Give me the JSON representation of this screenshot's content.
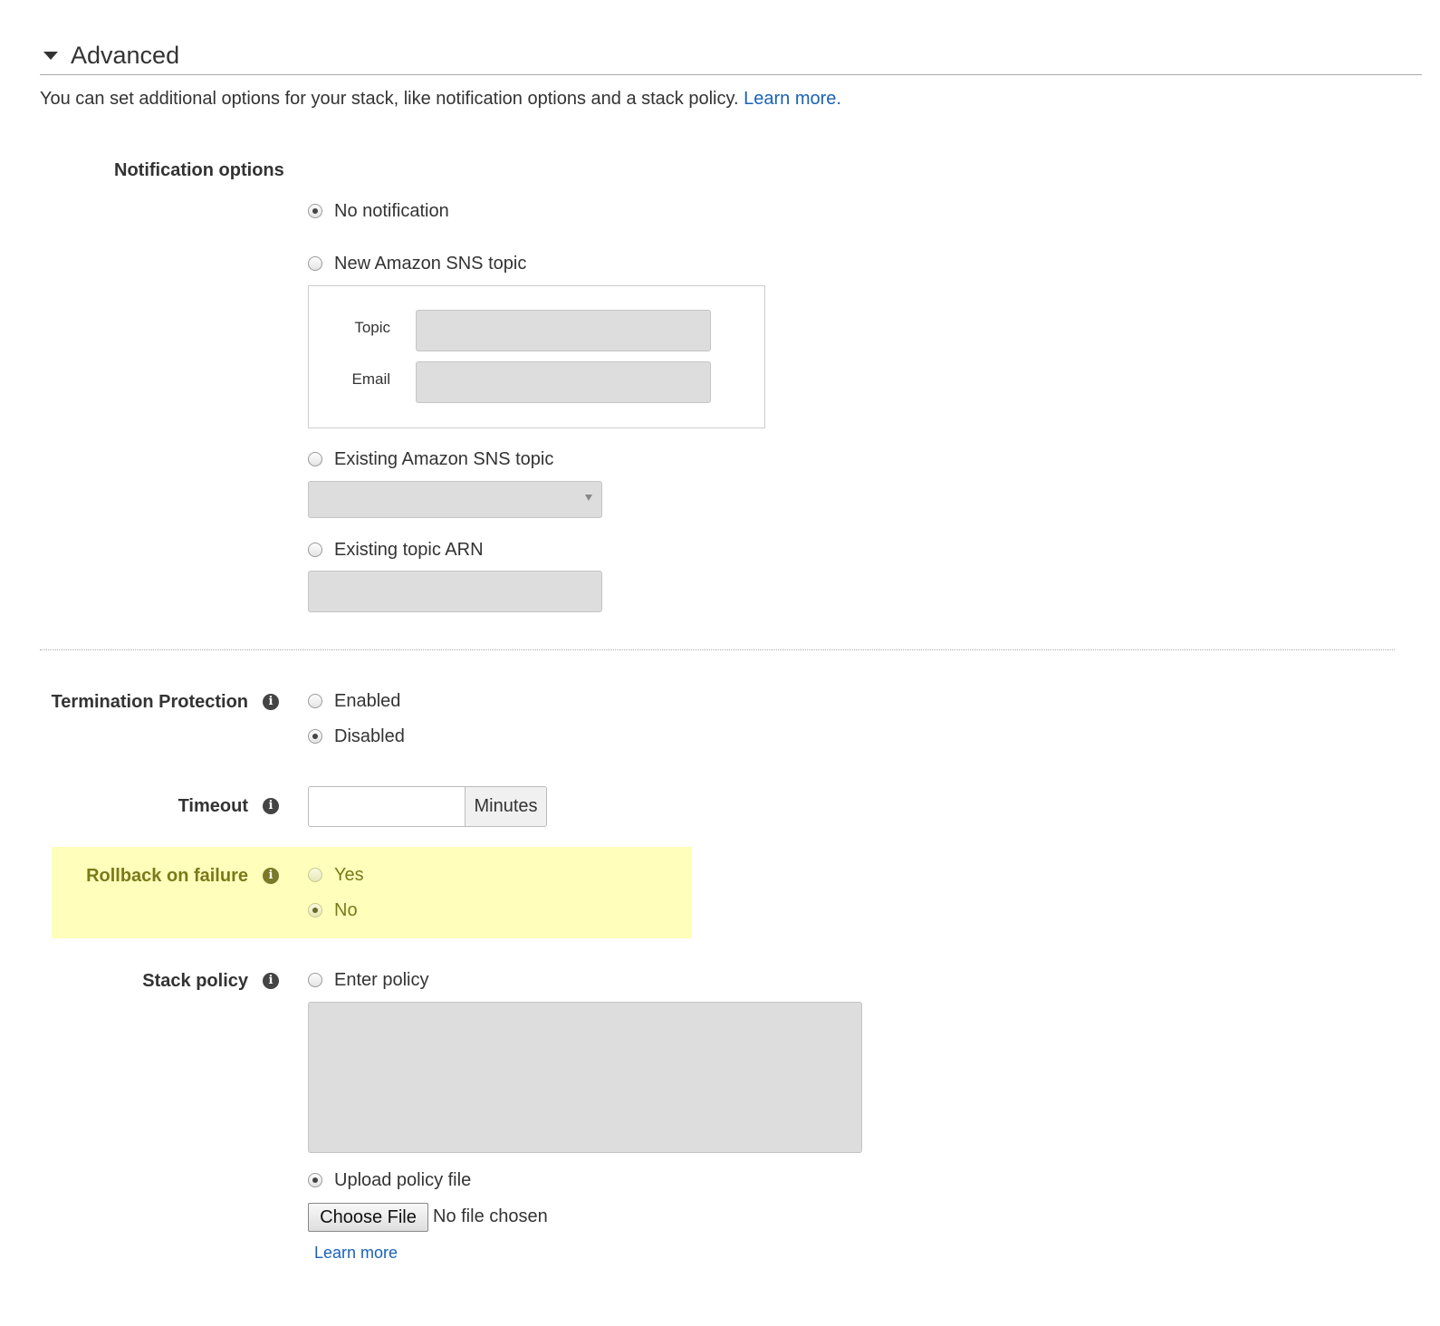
{
  "section": {
    "title": "Advanced",
    "intro": "You can set additional options for your stack, like notification options and a stack policy.",
    "intro_link": "Learn more."
  },
  "notification": {
    "heading": "Notification options",
    "options": {
      "none": "No notification",
      "new_sns": "New Amazon SNS topic",
      "existing_sns": "Existing Amazon SNS topic",
      "existing_arn": "Existing topic ARN"
    },
    "selected": "none",
    "topic_label": "Topic",
    "email_label": "Email"
  },
  "termination": {
    "label": "Termination Protection",
    "enabled": "Enabled",
    "disabled": "Disabled",
    "selected": "disabled"
  },
  "timeout": {
    "label": "Timeout",
    "value": "",
    "unit": "Minutes"
  },
  "rollback": {
    "label": "Rollback on failure",
    "yes": "Yes",
    "no": "No",
    "selected": "no",
    "highlight_color": "#ffffbb"
  },
  "stack_policy": {
    "label": "Stack policy",
    "enter": "Enter policy",
    "upload": "Upload policy file",
    "selected": "upload",
    "choose_button": "Choose File",
    "file_status": "No file chosen",
    "learn_more": "Learn more"
  },
  "icons": {
    "caret": "caret-down-icon",
    "info": "info-icon"
  },
  "colors": {
    "link": "#1a62b5",
    "disabled_field": "#dddddd"
  }
}
